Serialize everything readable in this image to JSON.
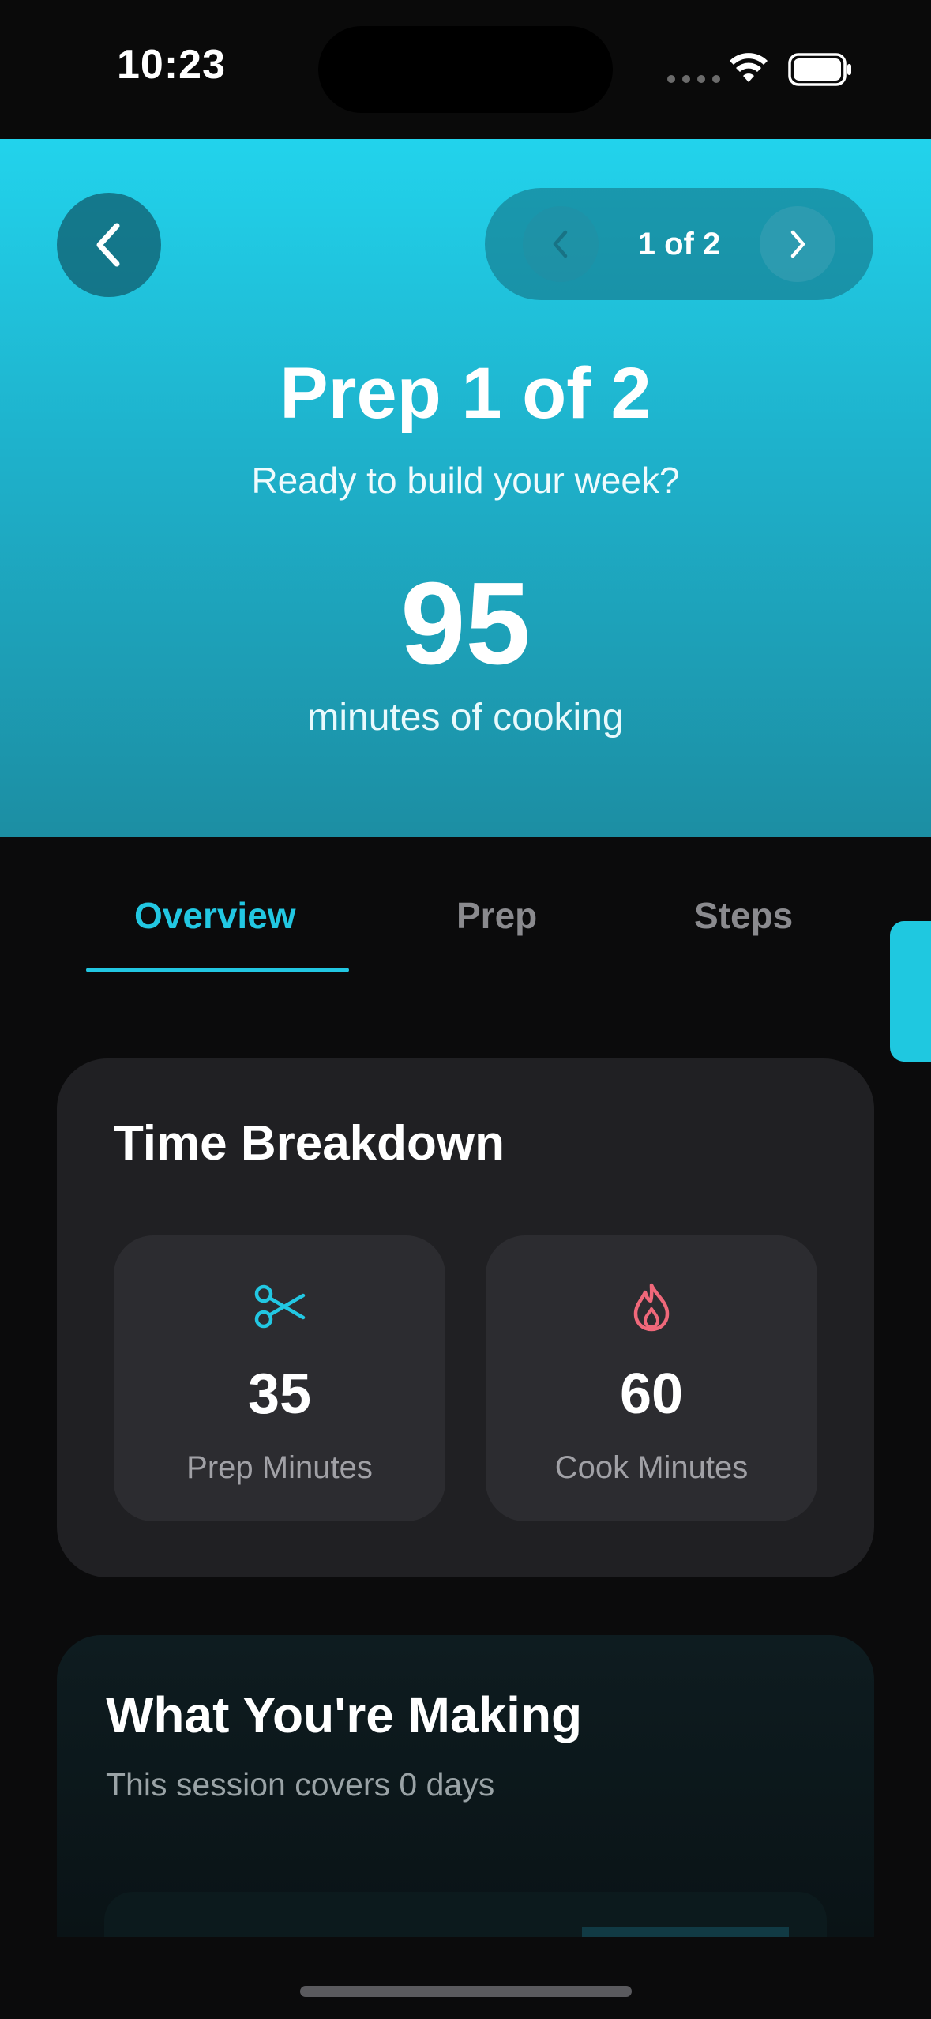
{
  "status_bar": {
    "time": "10:23"
  },
  "header": {
    "pager_label": "1 of 2"
  },
  "hero": {
    "title": "Prep 1 of 2",
    "subtitle": "Ready to build your week?",
    "minutes": "95",
    "minutes_caption": "minutes of cooking"
  },
  "tabs": [
    {
      "label": "Overview",
      "active": true
    },
    {
      "label": "Prep",
      "active": false
    },
    {
      "label": "Steps",
      "active": false
    }
  ],
  "time_breakdown": {
    "title": "Time Breakdown",
    "prep": {
      "value": "35",
      "label": "Prep Minutes",
      "icon": "scissors-icon",
      "color": "#22c7e2"
    },
    "cook": {
      "value": "60",
      "label": "Cook Minutes",
      "icon": "flame-icon",
      "color": "#f0687a"
    }
  },
  "making": {
    "title": "What You're Making",
    "subtitle": "This session covers 0 days"
  },
  "colors": {
    "accent": "#22c7e2",
    "hero_top": "#22d3ec",
    "hero_bottom": "#1c8ea3",
    "card_bg": "#202023"
  }
}
